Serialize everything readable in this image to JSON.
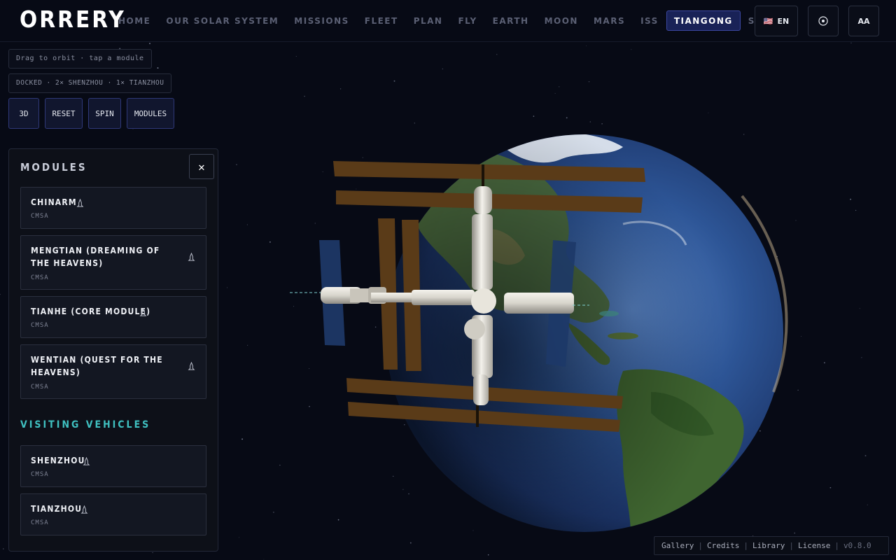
{
  "app": {
    "logo": "ORRERY"
  },
  "nav": {
    "items": [
      {
        "label": "HOME"
      },
      {
        "label": "OUR SOLAR SYSTEM"
      },
      {
        "label": "MISSIONS"
      },
      {
        "label": "FLEET"
      },
      {
        "label": "PLAN"
      },
      {
        "label": "FLY"
      },
      {
        "label": "EARTH"
      },
      {
        "label": "MOON"
      },
      {
        "label": "MARS"
      },
      {
        "label": "ISS"
      },
      {
        "label": "TIANGONG",
        "active": true
      },
      {
        "label": "SCIENCE"
      }
    ]
  },
  "topbar": {
    "language": {
      "flag": "🇺🇸",
      "label": "EN"
    },
    "target_icon": "target-icon",
    "font_size_label": "AA"
  },
  "hints": {
    "interaction": "Drag to orbit · tap a module",
    "docked": "DOCKED · 2× SHENZHOU · 1× TIANZHOU"
  },
  "controls": [
    {
      "label": "3D"
    },
    {
      "label": "RESET"
    },
    {
      "label": "SPIN"
    },
    {
      "label": "MODULES"
    }
  ],
  "panel": {
    "title": "MODULES",
    "close_icon": "close-icon",
    "modules": [
      {
        "name": "CHINARM",
        "agency": "CMSA",
        "icon": "rocket-icon"
      },
      {
        "name": "MENGTIAN (DREAMING OF THE HEAVENS)",
        "agency": "CMSA",
        "icon": "rocket-icon"
      },
      {
        "name": "TIANHE (CORE MODULE)",
        "agency": "CMSA",
        "icon": "rocket-icon"
      },
      {
        "name": "WENTIAN (QUEST FOR THE HEAVENS)",
        "agency": "CMSA",
        "icon": "rocket-icon"
      }
    ],
    "visiting_title": "VISITING VEHICLES",
    "vehicles": [
      {
        "name": "SHENZHOU",
        "agency": "CMSA",
        "icon": "rocket-icon"
      },
      {
        "name": "TIANZHOU",
        "agency": "CMSA",
        "icon": "rocket-icon"
      }
    ]
  },
  "footer": {
    "links": [
      "Gallery",
      "Credits",
      "Library",
      "License"
    ],
    "version": "v0.8.0"
  },
  "colors": {
    "background": "#070a15",
    "accent": "#3fc0c0",
    "active_nav": "#192257"
  }
}
